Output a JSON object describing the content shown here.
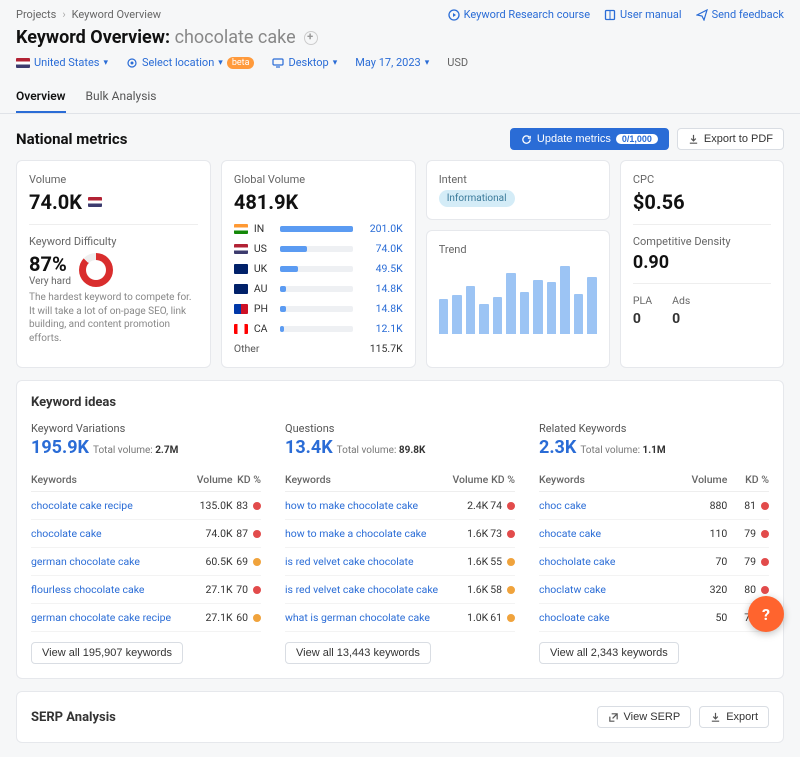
{
  "breadcrumb": {
    "root": "Projects",
    "current": "Keyword Overview"
  },
  "top_links": {
    "course": "Keyword Research course",
    "manual": "User manual",
    "feedback": "Send feedback"
  },
  "title": {
    "prefix": "Keyword Overview:",
    "keyword": "chocolate cake"
  },
  "toolbar": {
    "country": "United States",
    "location": "Select location",
    "beta_label": "beta",
    "device": "Desktop",
    "date": "May 17, 2023",
    "currency": "USD"
  },
  "tabs": {
    "overview": "Overview",
    "bulk": "Bulk Analysis"
  },
  "section": {
    "title": "National metrics",
    "update_label": "Update metrics",
    "update_count": "0/1,000",
    "export_label": "Export to PDF"
  },
  "volume": {
    "label": "Volume",
    "value": "74.0K"
  },
  "kd_card": {
    "label": "Keyword Difficulty",
    "value": "87%",
    "level": "Very hard",
    "desc": "The hardest keyword to compete for. It will take a lot of on-page SEO, link building, and content promotion efforts."
  },
  "gv": {
    "label": "Global Volume",
    "value": "481.9K",
    "rows": [
      {
        "flag": "in",
        "cc": "IN",
        "val": "201.0K",
        "pct": 100
      },
      {
        "flag": "us",
        "cc": "US",
        "val": "74.0K",
        "pct": 37
      },
      {
        "flag": "uk",
        "cc": "UK",
        "val": "49.5K",
        "pct": 25
      },
      {
        "flag": "au",
        "cc": "AU",
        "val": "14.8K",
        "pct": 8
      },
      {
        "flag": "ph",
        "cc": "PH",
        "val": "14.8K",
        "pct": 8
      },
      {
        "flag": "ca",
        "cc": "CA",
        "val": "12.1K",
        "pct": 6
      }
    ],
    "other_label": "Other",
    "other_val": "115.7K"
  },
  "intent": {
    "label": "Intent",
    "value": "Informational"
  },
  "trend": {
    "label": "Trend",
    "bars": [
      40,
      45,
      55,
      35,
      42,
      70,
      48,
      62,
      60,
      78,
      46,
      65
    ]
  },
  "cpc": {
    "label": "CPC",
    "value": "$0.56",
    "cd_label": "Competitive Density",
    "cd_value": "0.90",
    "pla_label": "PLA",
    "pla_value": "0",
    "ads_label": "Ads",
    "ads_value": "0"
  },
  "ideas": {
    "title": "Keyword ideas",
    "headers": {
      "kw": "Keywords",
      "vol": "Volume",
      "kd": "KD %"
    },
    "variations": {
      "label": "Keyword Variations",
      "count": "195.9K",
      "total_label": "Total volume:",
      "total": "2.7M",
      "rows": [
        {
          "kw": "chocolate cake recipe",
          "vol": "135.0K",
          "kd": "83",
          "dot": "red"
        },
        {
          "kw": "chocolate cake",
          "vol": "74.0K",
          "kd": "87",
          "dot": "red"
        },
        {
          "kw": "german chocolate cake",
          "vol": "60.5K",
          "kd": "69",
          "dot": "orange"
        },
        {
          "kw": "flourless chocolate cake",
          "vol": "27.1K",
          "kd": "70",
          "dot": "red"
        },
        {
          "kw": "german chocolate cake recipe",
          "vol": "27.1K",
          "kd": "60",
          "dot": "orange"
        }
      ],
      "viewall": "View all 195,907 keywords"
    },
    "questions": {
      "label": "Questions",
      "count": "13.4K",
      "total_label": "Total volume:",
      "total": "89.8K",
      "rows": [
        {
          "kw": "how to make chocolate cake",
          "vol": "2.4K",
          "kd": "74",
          "dot": "red"
        },
        {
          "kw": "how to make a chocolate cake",
          "vol": "1.6K",
          "kd": "73",
          "dot": "red"
        },
        {
          "kw": "is red velvet cake chocolate",
          "vol": "1.6K",
          "kd": "55",
          "dot": "orange"
        },
        {
          "kw": "is red velvet cake chocolate cake",
          "vol": "1.6K",
          "kd": "58",
          "dot": "orange"
        },
        {
          "kw": "what is german chocolate cake",
          "vol": "1.0K",
          "kd": "61",
          "dot": "orange"
        }
      ],
      "viewall": "View all 13,443 keywords"
    },
    "related": {
      "label": "Related Keywords",
      "count": "2.3K",
      "total_label": "Total volume:",
      "total": "1.1M",
      "rows": [
        {
          "kw": "choc cake",
          "vol": "880",
          "kd": "81",
          "dot": "red"
        },
        {
          "kw": "chocate cake",
          "vol": "110",
          "kd": "79",
          "dot": "red"
        },
        {
          "kw": "chocholate cake",
          "vol": "70",
          "kd": "79",
          "dot": "red"
        },
        {
          "kw": "choclatw cake",
          "vol": "320",
          "kd": "80",
          "dot": "red"
        },
        {
          "kw": "chocloate cake",
          "vol": "50",
          "kd": "79",
          "dot": "red"
        }
      ],
      "viewall": "View all 2,343 keywords"
    }
  },
  "serp": {
    "title": "SERP Analysis",
    "view": "View SERP",
    "export": "Export"
  }
}
